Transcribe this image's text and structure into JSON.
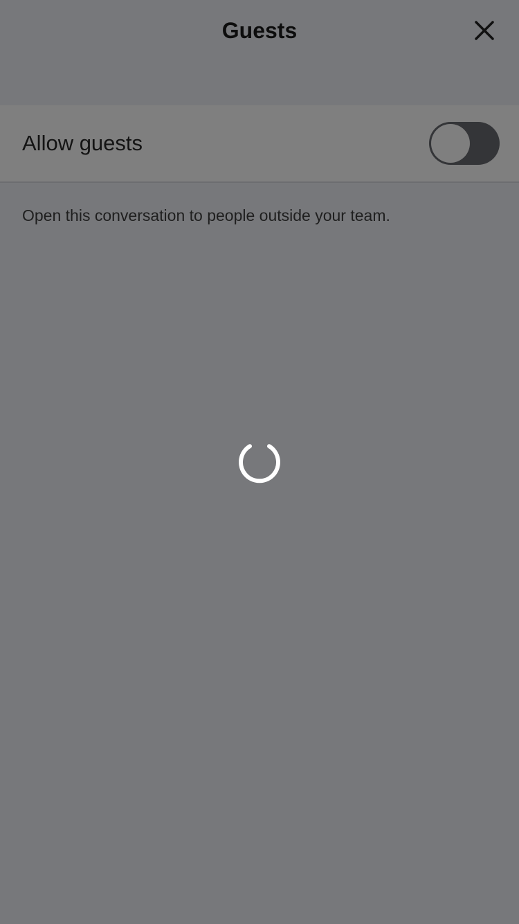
{
  "header": {
    "title": "Guests",
    "close_icon": "close-icon"
  },
  "settings": {
    "allow_guests_label": "Allow guests",
    "allow_guests_enabled": false,
    "description": "Open this conversation to people outside your team."
  },
  "loading": {
    "icon": "loading-spinner-icon"
  },
  "colors": {
    "background": "#77787b",
    "row_background": "#7f7f7f",
    "switch_track": "#343538",
    "spinner": "#ffffff"
  }
}
